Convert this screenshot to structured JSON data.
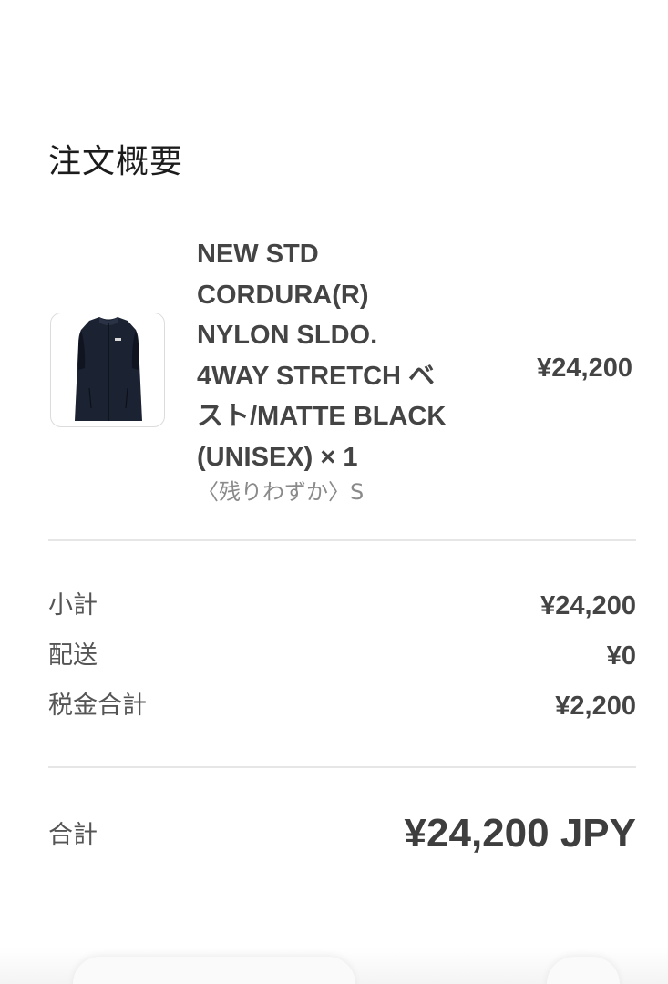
{
  "summary": {
    "title": "注文概要"
  },
  "item": {
    "name_lines": [
      "NEW STD",
      "CORDURA(R)",
      "NYLON SLDO.",
      "4WAY STRETCH ベ",
      "スト/MATTE BLACK",
      "(UNISEX) × 1"
    ],
    "variant": "〈残りわずか〉S",
    "price": "¥24,200",
    "image_icon": "black-vest-image"
  },
  "totals": {
    "subtotal_label": "小計",
    "subtotal_value": "¥24,200",
    "shipping_label": "配送",
    "shipping_value": "¥0",
    "tax_label": "税金合計",
    "tax_value": "¥2,200",
    "total_label": "合計",
    "total_value": "¥24,200 JPY"
  },
  "colors": {
    "text_primary": "#444444",
    "text_muted": "#8a8a8a",
    "divider": "#e6e6e6",
    "product": "#1a2233"
  }
}
